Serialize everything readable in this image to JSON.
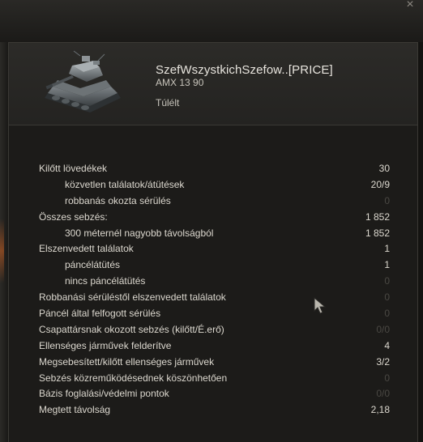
{
  "window": {
    "close_glyph": "×"
  },
  "header": {
    "player_name": "SzefWszystkichSzefow..[PRICE]",
    "vehicle_name": "AMX 13 90",
    "status": "Túlélt",
    "tank_icon": "tank-image"
  },
  "stats": [
    {
      "label": "Kilőtt lövedékek",
      "value": "30",
      "indent": false,
      "dim": false
    },
    {
      "label": "közvetlen találatok/átütések",
      "value": "20/9",
      "indent": true,
      "dim": false
    },
    {
      "label": "robbanás okozta sérülés",
      "value": "0",
      "indent": true,
      "dim": true
    },
    {
      "label": "Összes sebzés:",
      "value": "1 852",
      "indent": false,
      "dim": false
    },
    {
      "label": "300 méternél nagyobb távolságból",
      "value": "1 852",
      "indent": true,
      "dim": false
    },
    {
      "label": "Elszenvedett találatok",
      "value": "1",
      "indent": false,
      "dim": false
    },
    {
      "label": "páncélátütés",
      "value": "1",
      "indent": true,
      "dim": false
    },
    {
      "label": "nincs páncélátütés",
      "value": "0",
      "indent": true,
      "dim": true
    },
    {
      "label": "Robbanási sérüléstől elszenvedett találatok",
      "value": "0",
      "indent": false,
      "dim": true
    },
    {
      "label": "Páncél által felfogott sérülés",
      "value": "0",
      "indent": false,
      "dim": true
    },
    {
      "label": "Csapattársnak okozott sebzés (kilőtt/É.erő)",
      "value": "0/0",
      "indent": false,
      "dim": true
    },
    {
      "label": "Ellenséges járművek felderítve",
      "value": "4",
      "indent": false,
      "dim": false
    },
    {
      "label": "Megsebesített/kilőtt ellenséges járművek",
      "value": "3/2",
      "indent": false,
      "dim": false
    },
    {
      "label": "Sebzés közreműködésednek köszönhetően",
      "value": "0",
      "indent": false,
      "dim": true
    },
    {
      "label": "Bázis foglalási/védelmi pontok",
      "value": "0/0",
      "indent": false,
      "dim": true
    },
    {
      "label": "Megtett távolság",
      "value": "2,18",
      "indent": false,
      "dim": false
    }
  ],
  "colors": {
    "text": "#dcd8cf",
    "dim_value": "#4a4843",
    "panel_bg": "#1c1b19",
    "header_bg": "#2c2b28"
  }
}
